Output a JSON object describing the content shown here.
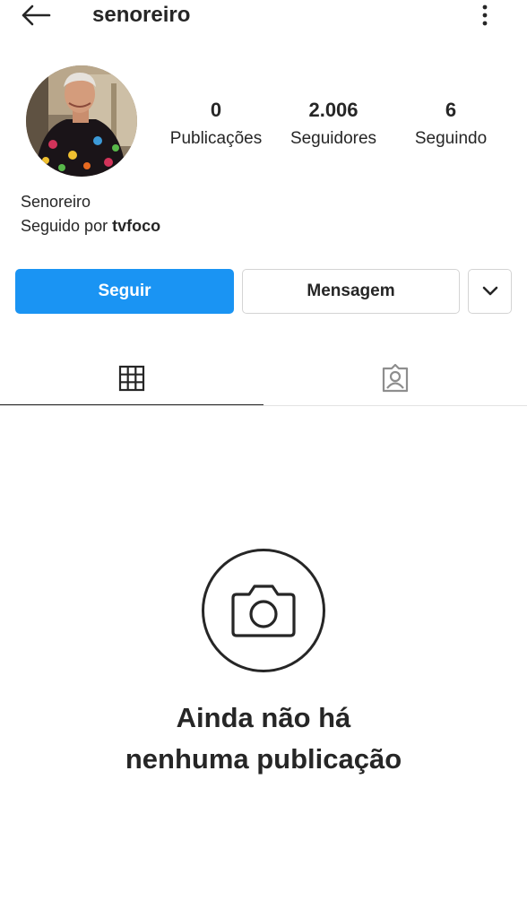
{
  "header": {
    "username": "senoreiro"
  },
  "profile": {
    "full_name": "Senoreiro",
    "followed_by_prefix": "Seguido por ",
    "followed_by_user": "tvfoco"
  },
  "stats": [
    {
      "value": "0",
      "label": "Publicações"
    },
    {
      "value": "2.006",
      "label": "Seguidores"
    },
    {
      "value": "6",
      "label": "Seguindo"
    }
  ],
  "actions": {
    "follow_label": "Seguir",
    "message_label": "Mensagem"
  },
  "tabs": [
    {
      "icon": "grid-icon",
      "active": true
    },
    {
      "icon": "tagged-icon",
      "active": false
    }
  ],
  "empty_state": {
    "line1": "Ainda não há",
    "line2": "nenhuma publicação"
  },
  "colors": {
    "accent": "#1a94f3",
    "text": "#262626",
    "border": "#d4d4d4"
  }
}
